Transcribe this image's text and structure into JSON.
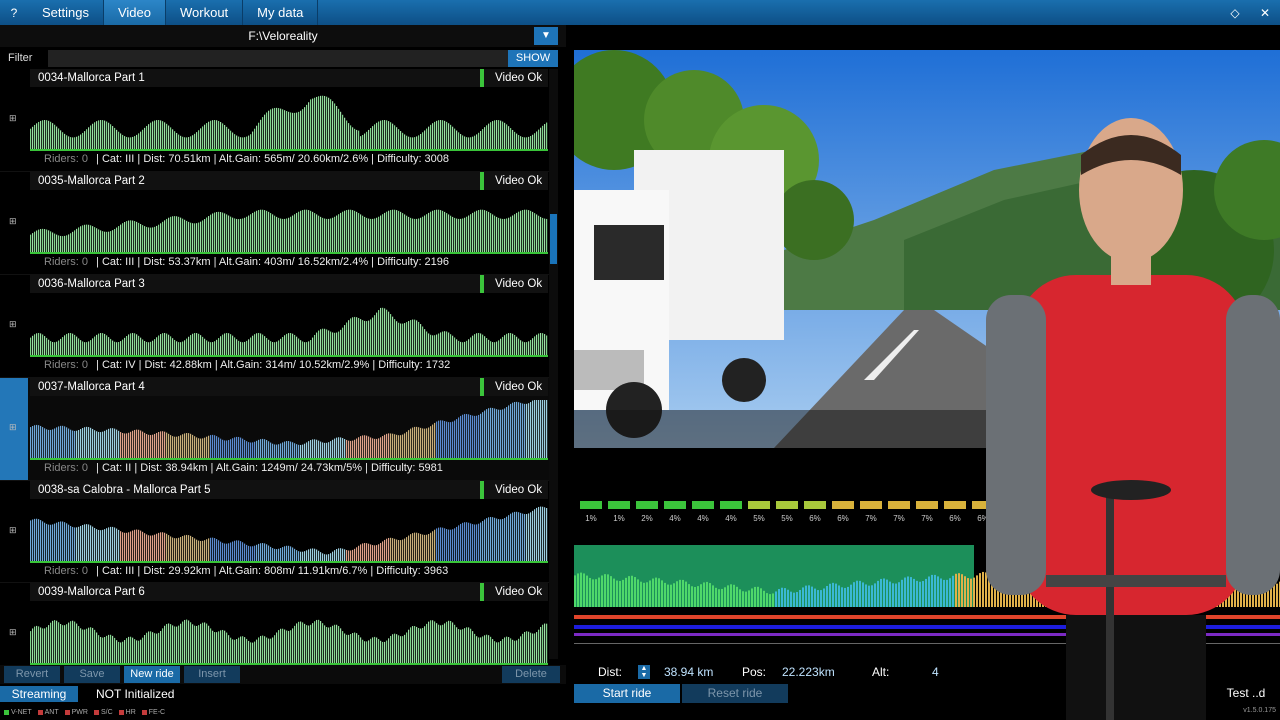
{
  "topbar": {
    "help": "?",
    "tabs": [
      {
        "label": "Settings",
        "active": false
      },
      {
        "label": "Video",
        "active": true
      },
      {
        "label": "Workout",
        "active": false
      },
      {
        "label": "My data",
        "active": false
      }
    ],
    "icons": [
      "diamond-icon",
      "close-icon"
    ]
  },
  "library": {
    "path": "F:\\Veloreality",
    "filter_label": "Filter",
    "filter_value": "",
    "show_label": "SHOW",
    "rides": [
      {
        "title": "0034-Mallorca Part 1",
        "status": "Video Ok",
        "riders": "Riders: 0",
        "info": "| Cat: III | Dist: 70.51km | Alt.Gain: 565m/ 20.60km/2.6% | Difficulty: 3008",
        "selected": false,
        "profile": "peak"
      },
      {
        "title": "0035-Mallorca Part 2",
        "status": "Video Ok",
        "riders": "Riders: 0",
        "info": "| Cat: III | Dist: 53.37km | Alt.Gain: 403m/ 16.52km/2.4% | Difficulty: 2196",
        "selected": false,
        "profile": "plateau"
      },
      {
        "title": "0036-Mallorca Part 3",
        "status": "Video Ok",
        "riders": "Riders: 0",
        "info": "| Cat: IV | Dist: 42.88km | Alt.Gain: 314m/ 10.52km/2.9% | Difficulty: 1732",
        "selected": false,
        "profile": "late"
      },
      {
        "title": "0037-Mallorca Part 4",
        "status": "Video Ok",
        "riders": "Riders: 0",
        "info": "| Cat: II | Dist: 38.94km | Alt.Gain: 1249m/ 24.73km/5% | Difficulty: 5981",
        "selected": true,
        "profile": "valley"
      },
      {
        "title": "0038-sa Calobra - Mallorca Part 5",
        "status": "Video Ok",
        "riders": "Riders: 0",
        "info": "| Cat: III | Dist: 29.92km | Alt.Gain: 808m/ 11.91km/6.7% | Difficulty: 3963",
        "selected": false,
        "profile": "descent"
      },
      {
        "title": "0039-Mallorca Part 6",
        "status": "Video Ok",
        "riders": "",
        "info": "",
        "selected": false,
        "profile": "rolling"
      }
    ]
  },
  "buttons": {
    "revert": "Revert",
    "save": "Save",
    "new_ride": "New ride",
    "insert": "Insert",
    "delete": "Delete"
  },
  "status": {
    "streaming": "Streaming",
    "state": "NOT Initialized",
    "indicators": [
      "V-NET",
      "ANT",
      "PWR",
      "S/C",
      "HR",
      "FE-C"
    ]
  },
  "hud": {
    "grades": [
      "1%",
      "1%",
      "2%",
      "4%",
      "4%",
      "4%",
      "5%",
      "5%",
      "6%",
      "6%",
      "7%",
      "7%",
      "7%",
      "6%",
      "6%"
    ],
    "dist_label": "Dist:",
    "dist_value": "38.94 km",
    "pos_label": "Pos:",
    "pos_value": "22.223km",
    "alt_label": "Alt:",
    "alt_value": "4",
    "start_ride": "Start ride",
    "reset_ride": "Reset ride",
    "test_mode": "Test  ..d",
    "version": "v1.5.0.175"
  },
  "colors": {
    "accent": "#1a6aa6",
    "ok": "#3bc43b",
    "selected": "#2377b8"
  }
}
